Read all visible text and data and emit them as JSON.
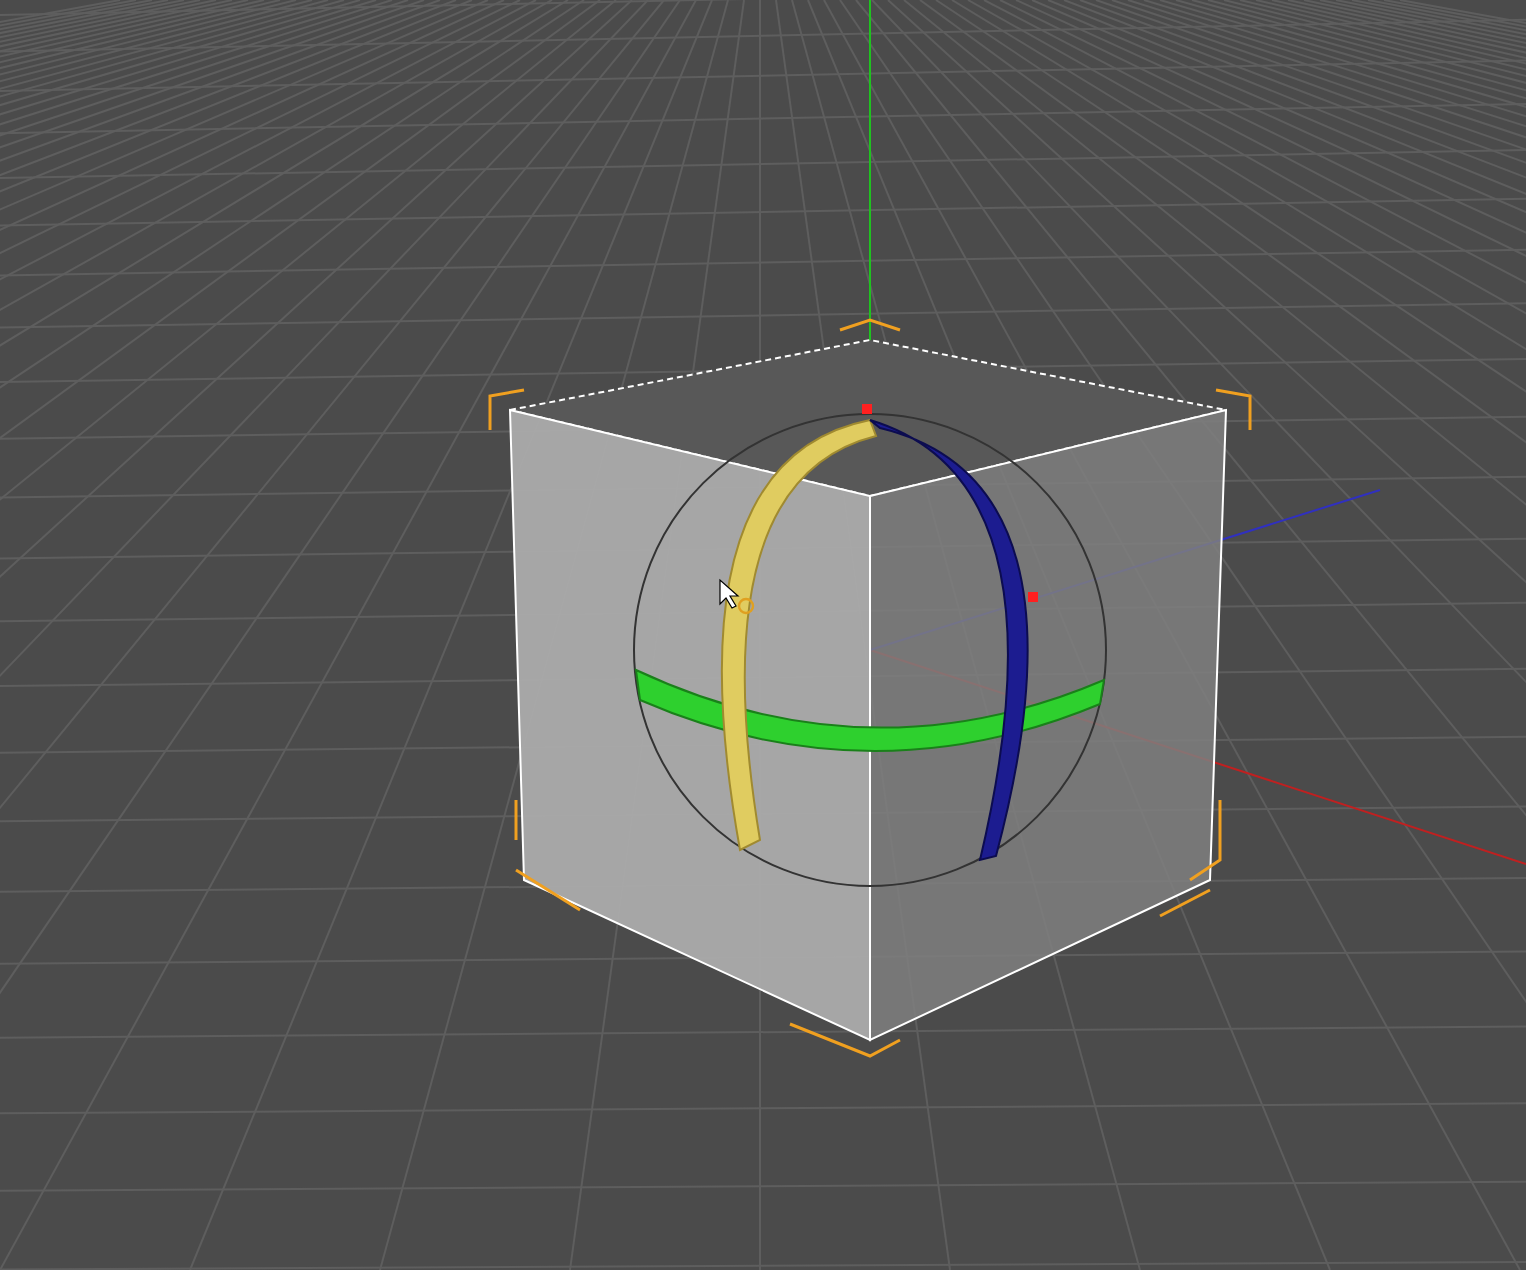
{
  "viewport": {
    "show_grid": true,
    "cube_selected": true,
    "rotate_gizmo": true
  }
}
